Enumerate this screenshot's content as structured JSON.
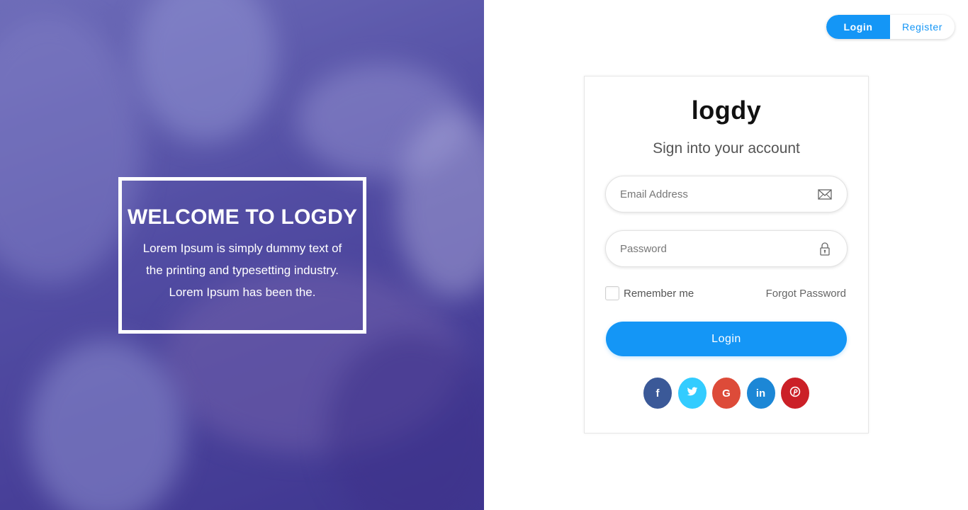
{
  "hero": {
    "title": "WELCOME TO LOGDY",
    "text": "Lorem Ipsum is simply dummy text of the printing and typesetting industry. Lorem Ipsum has been the."
  },
  "toggle": {
    "login_label": "Login",
    "register_label": "Register"
  },
  "card": {
    "logo": "logdy",
    "subtitle": "Sign into your account",
    "email_placeholder": "Email Address",
    "password_placeholder": "Password",
    "remember_label": "Remember me",
    "forgot_label": "Forgot Password",
    "login_label": "Login"
  },
  "social": [
    {
      "name": "facebook",
      "glyph": "f",
      "color": "#3b5998"
    },
    {
      "name": "twitter",
      "glyph": "t",
      "color": "#33ccff"
    },
    {
      "name": "google",
      "glyph": "G",
      "color": "#dd4b39"
    },
    {
      "name": "linkedin",
      "glyph": "in",
      "color": "#1c87d6"
    },
    {
      "name": "pinterest",
      "glyph": "P",
      "color": "#cb2027"
    }
  ],
  "colors": {
    "accent": "#1496f6",
    "hero_overlay": "#4b4397"
  }
}
